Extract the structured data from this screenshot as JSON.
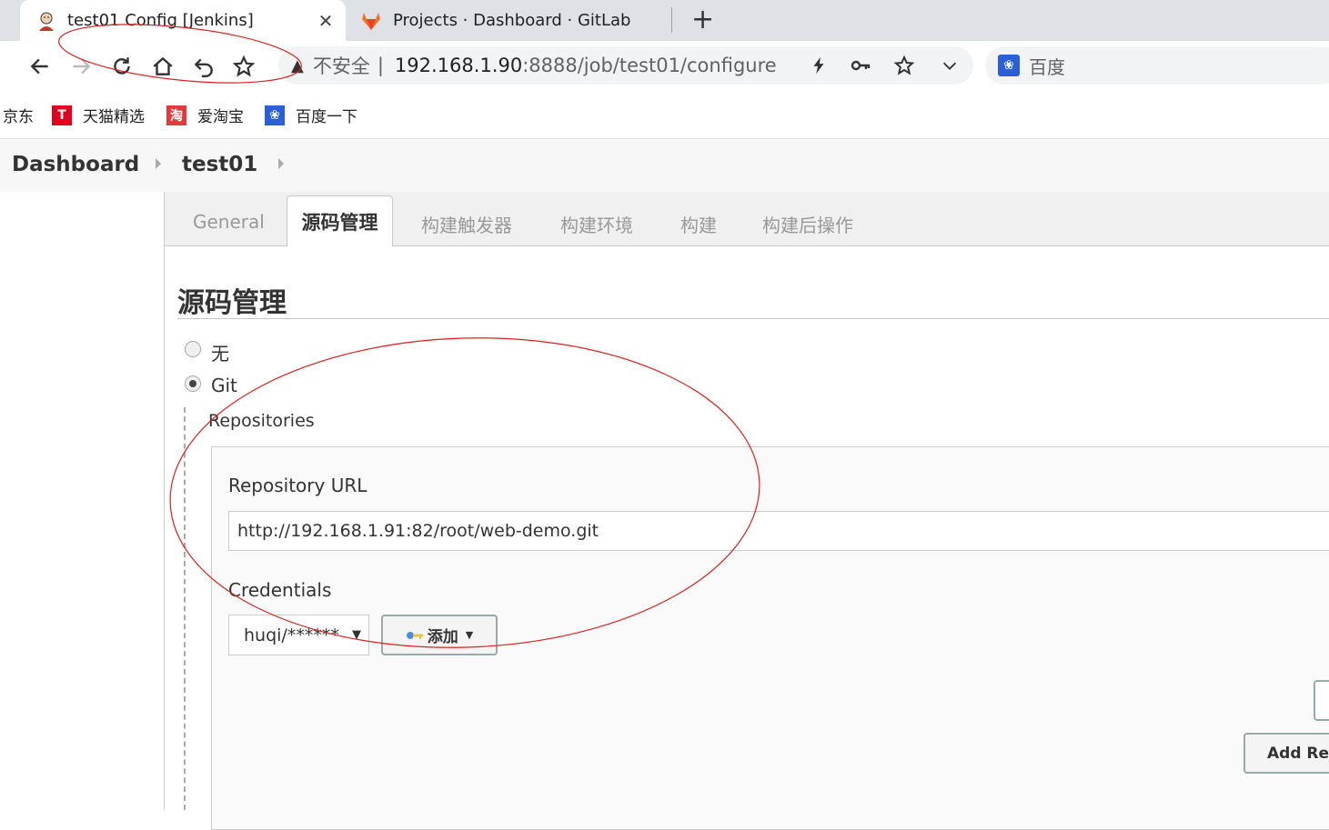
{
  "browser": {
    "tabs": [
      {
        "title": "test01 Config [Jenkins]",
        "icon": "jenkins-icon",
        "active": true
      },
      {
        "title": "Projects · Dashboard · GitLab",
        "icon": "gitlab-icon",
        "active": false
      }
    ],
    "close_glyph": "✕",
    "new_tab_glyph": "+",
    "address": {
      "warning_glyph": "▲",
      "insecure_label": "不安全",
      "separator": "|",
      "host": "192.168.1.90",
      "path": ":8888/job/test01/configure"
    },
    "search_placeholder": "百度",
    "bookmarks": [
      {
        "label": "京东",
        "icon": ""
      },
      {
        "label": "天猫精选",
        "icon": "tmall-icon",
        "glyph": "T",
        "color": "#e4001c"
      },
      {
        "label": "爱淘宝",
        "icon": "taobao-icon",
        "glyph": "淘",
        "color": "#e4393c"
      },
      {
        "label": "百度一下",
        "icon": "baidu-icon",
        "glyph": "❀",
        "color": "#2b5fd9"
      }
    ]
  },
  "jenkins": {
    "breadcrumbs": [
      "Dashboard",
      "test01"
    ],
    "config_tabs": [
      "General",
      "源码管理",
      "构建触发器",
      "构建环境",
      "构建",
      "构建后操作"
    ],
    "active_tab_index": 1,
    "section_title": "源码管理",
    "scm_options": [
      {
        "label": "无",
        "selected": false
      },
      {
        "label": "Git",
        "selected": true
      }
    ],
    "repositories_label": "Repositories",
    "repository_url_label": "Repository URL",
    "repository_url_value": "http://192.168.1.91:82/root/web-demo.git",
    "credentials_label": "Credentials",
    "credentials_value": "huqi/******",
    "add_button_label": "添加",
    "add_repository_label": "Add Rep"
  },
  "colors": {
    "annotation": "#e02020",
    "gitlab": "#fc6d26"
  }
}
